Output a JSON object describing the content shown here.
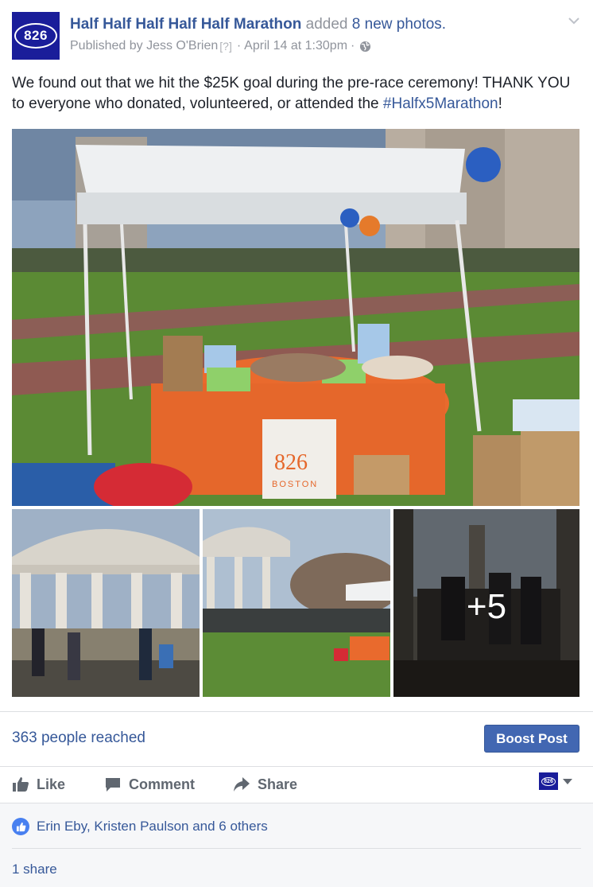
{
  "post": {
    "page_name": "Half Half Half Half Half Marathon",
    "action_text": "added",
    "action_link": "8 new photos.",
    "avatar_label": "826",
    "published_by": "Published by Jess O'Brien",
    "help_mark": "[?]",
    "separator": "·",
    "timestamp": "April 14 at 1:30pm",
    "text_main": "We found out that we hit the $25K goal during the pre-race ceremony! THANK YOU to everyone who donated, volunteered, or attended the ",
    "hashtag": "#Halfx5Marathon",
    "text_end": "!"
  },
  "photos": {
    "more_count": "+5",
    "banner_line1": "826",
    "banner_line2": "BOSTON"
  },
  "insights": {
    "reach": "363 people reached",
    "boost_label": "Boost Post"
  },
  "actions": {
    "like": "Like",
    "comment": "Comment",
    "share": "Share",
    "mini_avatar": "826"
  },
  "reactions": {
    "likes_text": "Erin Eby, Kristen Paulson and 6 others",
    "shares_text": "1 share"
  },
  "colors": {
    "link_blue": "#365899",
    "boost_blue": "#4267b2",
    "brand_navy": "#1a1d9a",
    "meta_gray": "#90949c",
    "action_gray": "#606770"
  }
}
